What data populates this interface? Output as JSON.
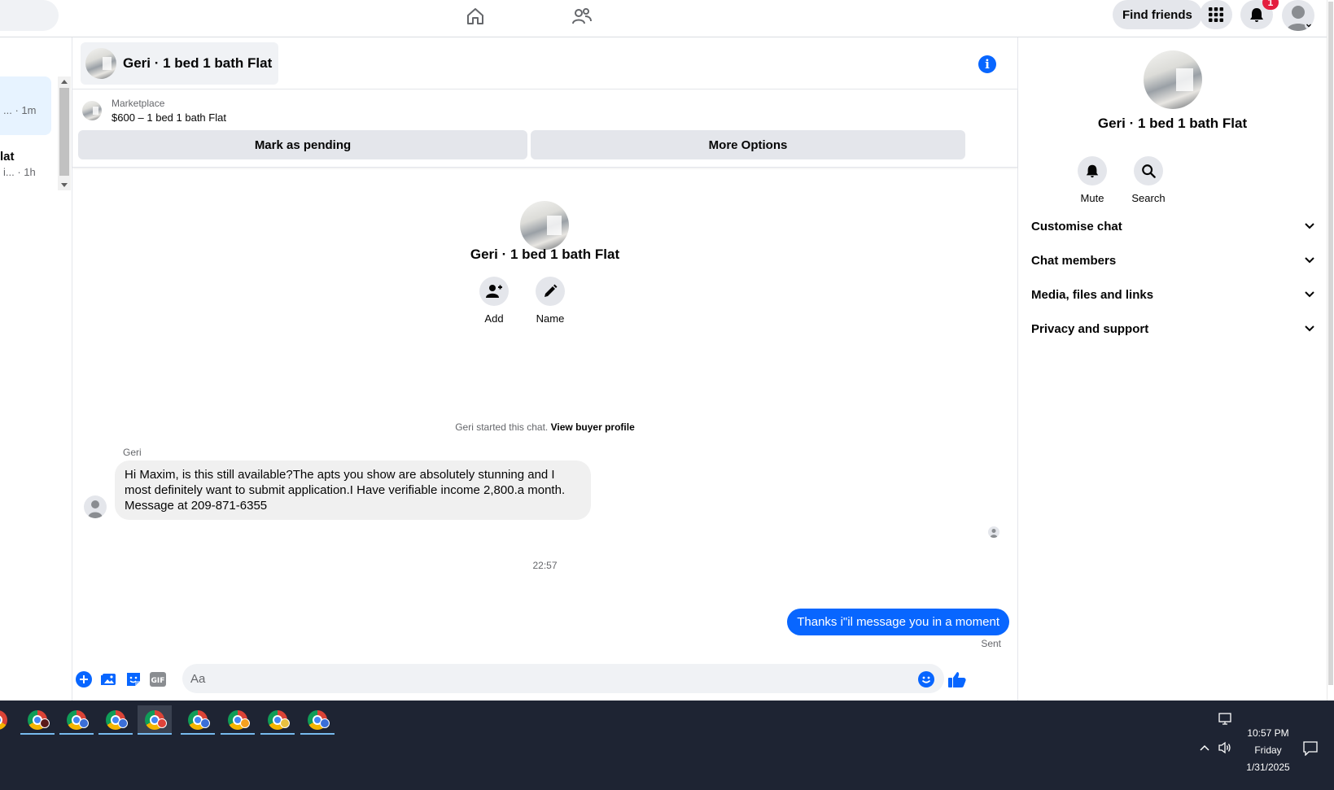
{
  "topnav": {
    "find_friends": "Find friends",
    "notification_count": "1"
  },
  "left_list": {
    "active_meta": "... · 1m",
    "item2_title": "lat",
    "item2_meta": "i... · 1h"
  },
  "chat": {
    "title": "Geri · 1 bed 1 bath Flat",
    "marketplace_label": "Marketplace",
    "listing": "$600 – 1 bed 1 bath Flat",
    "mark_pending": "Mark as pending",
    "more_options": "More Options",
    "center_name": "Geri · 1 bed 1 bath Flat",
    "add_label": "Add",
    "name_label": "Name",
    "started_text": "Geri started this chat.",
    "view_buyer_profile": "View buyer profile",
    "sender": "Geri",
    "incoming_message": "Hi Maxim, is this still available?The apts you show are absolutely stunning and I most definitely want to submit application.I  Have verifiable income 2,800.a month. Message at 209-871-6355",
    "timestamp": "22:57",
    "outgoing_message": "Thanks i\"il message you in a moment",
    "sent_status": "Sent",
    "composer_placeholder": "Aa"
  },
  "right_panel": {
    "name": "Geri · 1 bed 1 bath Flat",
    "mute": "Mute",
    "search": "Search",
    "sections": [
      "Customise chat",
      "Chat members",
      "Media, files and links",
      "Privacy and support"
    ]
  },
  "taskbar": {
    "time": "10:57 PM",
    "day": "Friday",
    "date": "1/31/2025"
  },
  "colors": {
    "accent": "#0866ff",
    "bubble_in": "#f0f0f0",
    "taskbar": "#1e2433",
    "badge": "#e41e3f"
  }
}
